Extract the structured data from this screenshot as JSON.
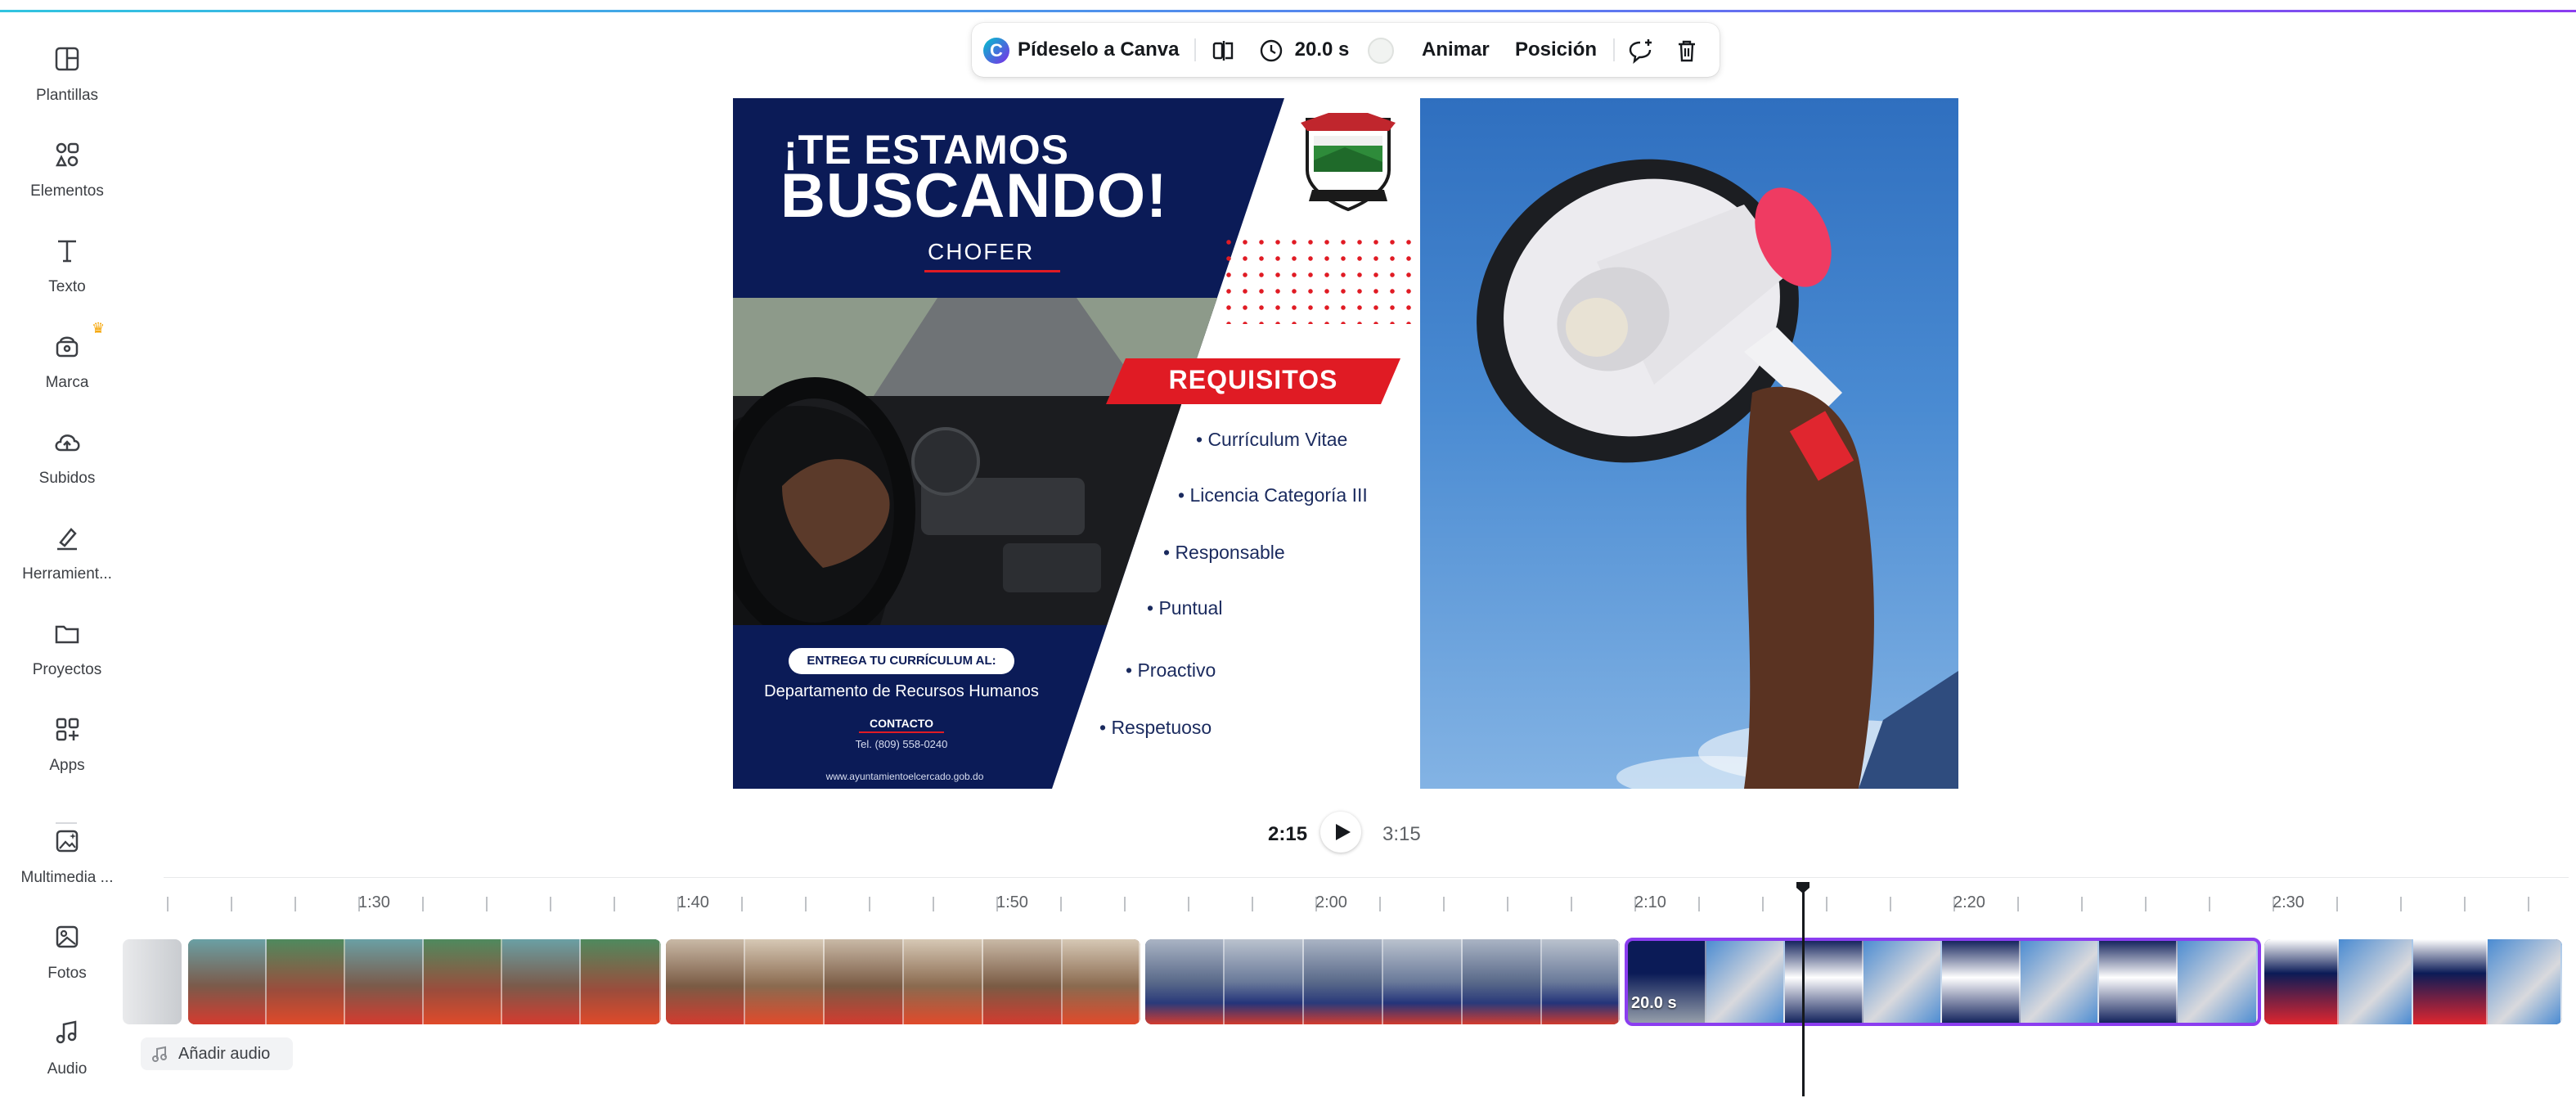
{
  "sidebar": {
    "items": [
      {
        "label": "Plantillas",
        "icon": "templates-icon"
      },
      {
        "label": "Elementos",
        "icon": "elements-icon"
      },
      {
        "label": "Texto",
        "icon": "text-icon"
      },
      {
        "label": "Marca",
        "icon": "brand-icon"
      },
      {
        "label": "Subidos",
        "icon": "upload-icon"
      },
      {
        "label": "Herramient...",
        "icon": "draw-icon"
      },
      {
        "label": "Proyectos",
        "icon": "folder-icon"
      },
      {
        "label": "Apps",
        "icon": "apps-icon"
      },
      {
        "label": "Multimedia ...",
        "icon": "magic-media-icon"
      },
      {
        "label": "Fotos",
        "icon": "photos-icon"
      },
      {
        "label": "Audio",
        "icon": "audio-icon"
      }
    ]
  },
  "toolbar": {
    "ask_canva": "Pídeselo a Canva",
    "duration": "20.0 s",
    "animate": "Animar",
    "position": "Posición"
  },
  "design": {
    "title_line1": "¡TE ESTAMOS",
    "title_line2": "BUSCANDO!",
    "role": "CHOFER",
    "requirements_title": "REQUISITOS",
    "requirements": [
      "• Currículum Vitae",
      "• Licencia Categoría III",
      "• Responsable",
      "• Puntual",
      "• Proactivo",
      "• Respetuoso"
    ],
    "deliver_label": "ENTREGA TU CURRÍCULUM AL:",
    "department": "Departamento de Recursos Humanos",
    "contact_label": "CONTACTO",
    "phone": "Tel. (809) 558-0240",
    "website": "www.ayuntamientoelcercado.gob.do"
  },
  "playback": {
    "current": "2:15",
    "total": "3:15"
  },
  "timeline": {
    "ruler_labels": [
      "1:30",
      "1:40",
      "1:50",
      "2:00",
      "2:10",
      "2:20",
      "2:30"
    ],
    "selected_clip_duration": "20.0 s",
    "selection_color": "#8b3df0"
  },
  "audio": {
    "add_label": "Añadir audio"
  },
  "colors": {
    "navy": "#0b1b57",
    "accent_red": "#e01b24"
  }
}
